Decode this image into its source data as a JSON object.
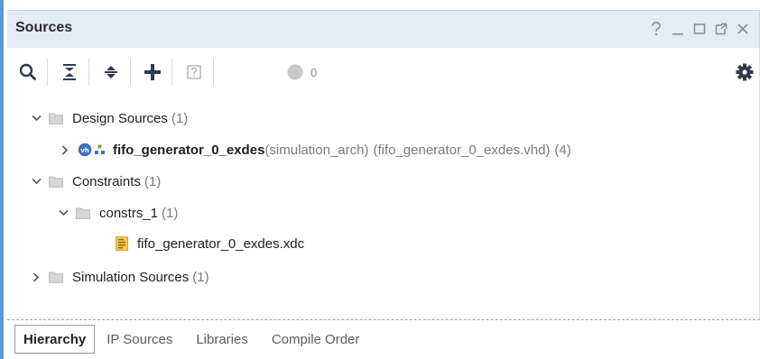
{
  "panel": {
    "title": "Sources",
    "window_controls": [
      "help-icon",
      "minimize-icon",
      "maximize-icon",
      "float-icon",
      "close-icon"
    ]
  },
  "toolbar": {
    "buttons": [
      "search-icon",
      "collapse-all-icon",
      "expand-all-icon",
      "add-icon",
      "help-box-icon",
      "status-circle-icon",
      "gear-icon"
    ],
    "status_count": "0"
  },
  "tree": {
    "design_sources": {
      "label": "Design Sources",
      "count": "(1)"
    },
    "top_module": {
      "name": "fifo_generator_0_exdes",
      "arch": "(simulation_arch)",
      "file": "(fifo_generator_0_exdes.vhd)",
      "count": "(4)"
    },
    "constraints": {
      "label": "Constraints",
      "count": "(1)"
    },
    "constrs_1": {
      "label": "constrs_1",
      "count": "(1)"
    },
    "xdc_file": {
      "label": "fifo_generator_0_exdes.xdc"
    },
    "simulation_sources": {
      "label": "Simulation Sources",
      "count": "(1)"
    }
  },
  "tabs": [
    {
      "label": "Hierarchy",
      "active": true
    },
    {
      "label": "IP Sources",
      "active": false
    },
    {
      "label": "Libraries",
      "active": false
    },
    {
      "label": "Compile Order",
      "active": false
    }
  ],
  "colors": {
    "title_bar_bg": "#e3ebf5",
    "accent_border": "#5b9bd5",
    "add_icon": "#1f5fa8",
    "gear_icon": "#2f3a4a"
  }
}
